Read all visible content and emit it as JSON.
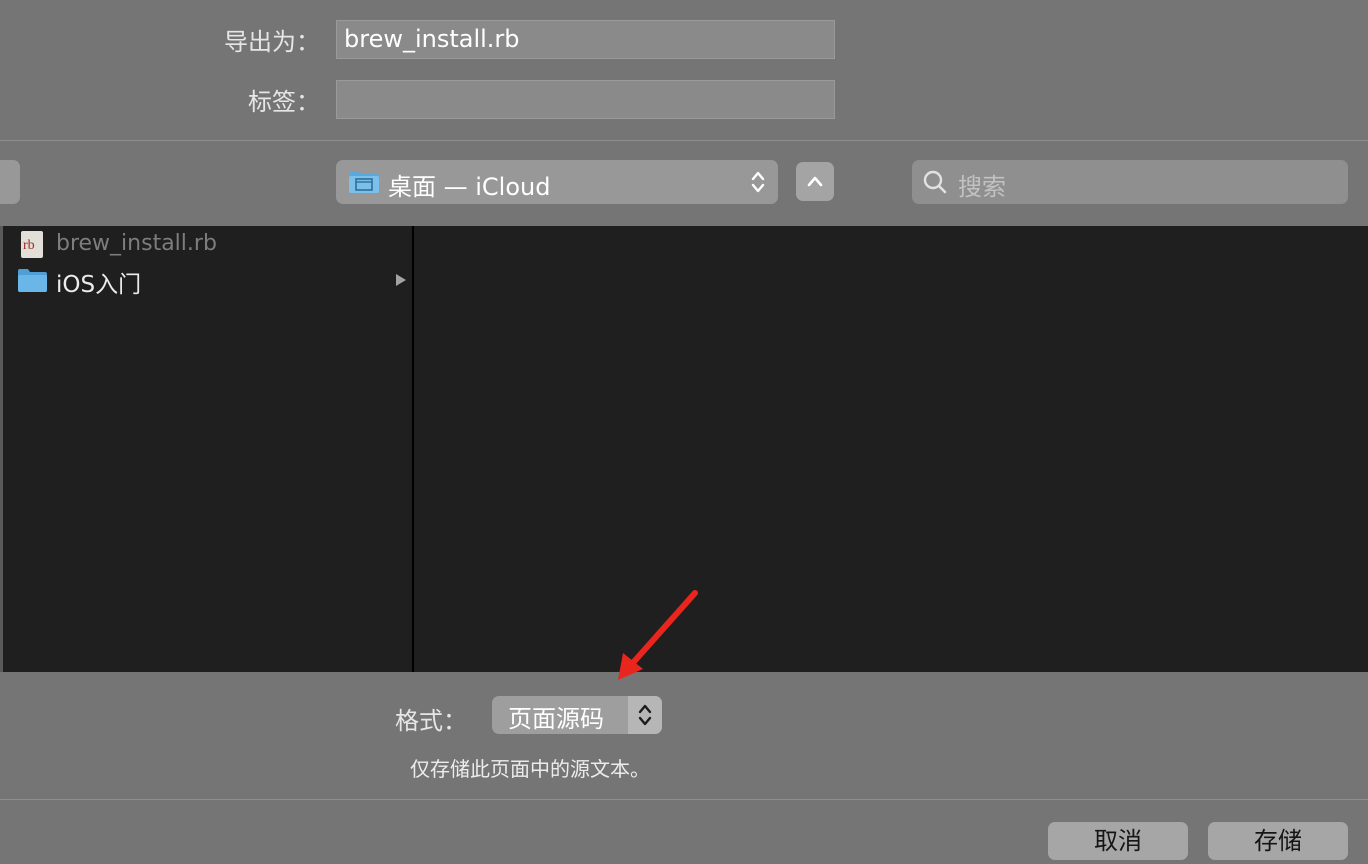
{
  "save_as": {
    "label": "导出为：",
    "value": "brew_install.rb"
  },
  "tags": {
    "label": "标签：",
    "value": ""
  },
  "location": {
    "label": "桌面 — iCloud"
  },
  "search": {
    "placeholder": "搜索"
  },
  "files": [
    {
      "name": "brew_install.rb",
      "icon": "ruby-file-icon",
      "badge": "rb",
      "dimmed": true
    },
    {
      "name": "iOS入门",
      "icon": "folder-icon",
      "has_children": true
    }
  ],
  "format": {
    "label": "格式：",
    "value": "页面源码",
    "description": "仅存储此页面中的源文本。"
  },
  "buttons": {
    "cancel": "取消",
    "save": "存储"
  },
  "annotation": {
    "color": "#e8261e"
  }
}
